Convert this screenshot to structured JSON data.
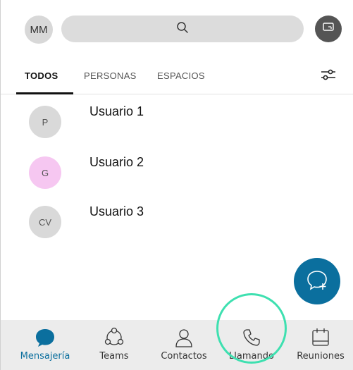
{
  "header": {
    "avatar_initials": "MM",
    "search_icon": "search-icon",
    "share_icon": "screen-share-icon"
  },
  "tabs": [
    {
      "label": "TODOS",
      "active": true
    },
    {
      "label": "PERSONAS",
      "active": false
    },
    {
      "label": "ESPACIOS",
      "active": false
    }
  ],
  "filter_icon": "filter-sliders-icon",
  "contacts": [
    {
      "initials": "P",
      "name": "Usuario 1",
      "avatar_color": "#d9d9d9"
    },
    {
      "initials": "G",
      "name": "Usuario 2",
      "avatar_color": "#f6c7f1"
    },
    {
      "initials": "CV",
      "name": "Usuario 3",
      "avatar_color": "#d9d9d9"
    }
  ],
  "fab": {
    "icon": "new-chat-icon",
    "color": "#0b6f9e"
  },
  "bottom_nav": [
    {
      "label": "Mensajería",
      "icon": "message-bubble-icon",
      "active": true
    },
    {
      "label": "Teams",
      "icon": "teams-icon",
      "active": false
    },
    {
      "label": "Contactos",
      "icon": "contacts-icon",
      "active": false
    },
    {
      "label": "Llamando",
      "icon": "phone-icon",
      "active": false
    },
    {
      "label": "Reuniones",
      "icon": "calendar-icon",
      "active": false
    }
  ],
  "colors": {
    "accent": "#0b6f9e",
    "highlight_ring": "#3ee0b0",
    "nav_background": "#ececec"
  }
}
